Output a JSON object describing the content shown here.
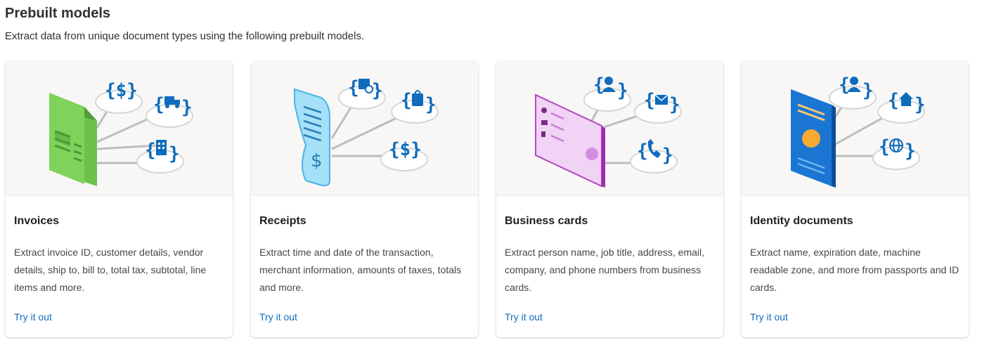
{
  "page": {
    "title": "Prebuilt models",
    "subtitle": "Extract data from unique document types using the following prebuilt models."
  },
  "cards": [
    {
      "title": "Invoices",
      "description": "Extract invoice ID, customer details, vendor details, ship to, bill to, total tax, subtotal, line items and more.",
      "link": "Try it out",
      "illustration": "invoice-document-illustration",
      "icons": [
        "dollar-icon",
        "truck-icon",
        "building-icon"
      ],
      "accent": "#5cb85c"
    },
    {
      "title": "Receipts",
      "description": "Extract time and date of the transaction, merchant information, amounts of taxes, totals and more.",
      "link": "Try it out",
      "illustration": "receipt-illustration",
      "icons": [
        "calendar-clock-icon",
        "shopping-bag-icon",
        "dollar-icon"
      ],
      "accent": "#49b5e7"
    },
    {
      "title": "Business cards",
      "description": "Extract person name, job title, address, email, company, and phone numbers from business cards.",
      "link": "Try it out",
      "illustration": "business-card-illustration",
      "icons": [
        "person-icon",
        "mail-icon",
        "phone-icon"
      ],
      "accent": "#b146c2"
    },
    {
      "title": "Identity documents",
      "description": "Extract name, expiration date, machine readable zone, and more from passports and ID cards.",
      "link": "Try it out",
      "illustration": "passport-illustration",
      "icons": [
        "person-icon",
        "home-icon",
        "globe-icon"
      ],
      "accent": "#1b76d3"
    }
  ],
  "colors": {
    "link": "#0f6cbd",
    "icon_blue": "#0f6cbd",
    "illustration_bg": "#f8f7f6"
  }
}
